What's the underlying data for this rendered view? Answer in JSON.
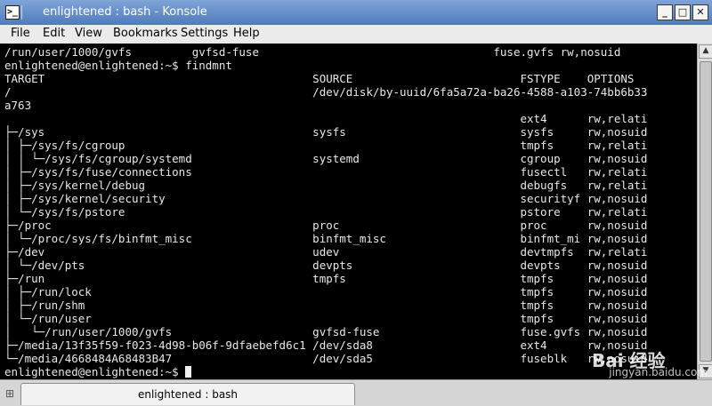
{
  "window": {
    "title": "enlightened : bash - Konsole",
    "app_icon": "terminal-app-icon",
    "app_icon_glyph": ">_",
    "buttons": [
      {
        "name": "minimize-button",
        "glyph": "_"
      },
      {
        "name": "maximize-button",
        "glyph": "□"
      },
      {
        "name": "close-button",
        "glyph": "✕"
      }
    ]
  },
  "menu": [
    "File",
    "Edit",
    "View",
    "Bookmarks",
    "Settings",
    "Help"
  ],
  "terminal": {
    "lines": [
      "/run/user/1000/gvfs         gvfsd-fuse                                   fuse.gvfs rw,nosuid",
      "enlightened@enlightened:~$ findmnt",
      "TARGET                                        SOURCE                         FSTYPE    OPTIONS",
      "/                                             /dev/disk/by-uuid/6fa5a72a-ba26-4588-a103-74bb6b33",
      "a763",
      "                                                                             ext4      rw,relati",
      "├─/sys                                        sysfs                          sysfs     rw,nosuid",
      "│ ├─/sys/fs/cgroup                                                           tmpfs     rw,relati",
      "│ │ └─/sys/fs/cgroup/systemd                  systemd                        cgroup    rw,nosuid",
      "│ ├─/sys/fs/fuse/connections                                                 fusectl   rw,relati",
      "│ ├─/sys/kernel/debug                                                        debugfs   rw,relati",
      "│ ├─/sys/kernel/security                                                     securityf rw,nosuid",
      "│ └─/sys/fs/pstore                                                           pstore    rw,relati",
      "├─/proc                                       proc                           proc      rw,nosuid",
      "│ └─/proc/sys/fs/binfmt_misc                  binfmt_misc                    binfmt_mi rw,nosuid",
      "├─/dev                                        udev                           devtmpfs  rw,relati",
      "│ └─/dev/pts                                  devpts                         devpts    rw,nosuid",
      "├─/run                                        tmpfs                          tmpfs     rw,nosuid",
      "│ ├─/run/lock                                                                tmpfs     rw,nosuid",
      "│ ├─/run/shm                                                                 tmpfs     rw,nosuid",
      "│ └─/run/user                                                                tmpfs     rw,nosuid",
      "│   └─/run/user/1000/gvfs                     gvfsd-fuse                     fuse.gvfs rw,nosuid",
      "├─/media/13f35f59-f023-4d98-b06f-9dfaebefd6c1 /dev/sda8                      ext4      rw,nosuid",
      "└─/media/4668484A68483B47                     /dev/sda5                      fuseblk   rw,nosuid"
    ],
    "prompt": "enlightened@enlightened:~$ "
  },
  "tabs": [
    {
      "label": "enlightened : bash"
    }
  ],
  "watermark": {
    "logo": "Bai 经验",
    "url": "jingyan.baidu.com"
  },
  "colors": {
    "titlebar": "#5f8bc8",
    "terminal_bg": "#000000",
    "terminal_fg": "#e8e8e8"
  }
}
